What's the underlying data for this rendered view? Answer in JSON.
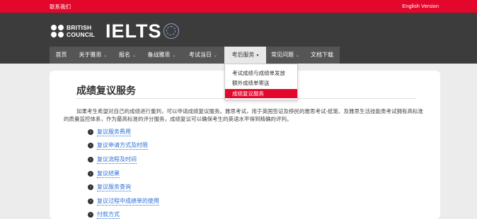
{
  "topbar": {
    "contact_label": "联系我们",
    "english_label": "English Version",
    "accent_color": "#e4072c"
  },
  "header": {
    "bc_logo_line1": "BRITISH",
    "bc_logo_line2": "COUNCIL",
    "ielts_logo": "IELTS"
  },
  "nav": {
    "items": [
      {
        "label": "首页",
        "caret": ""
      },
      {
        "label": "关于雅思",
        "caret": "⌄"
      },
      {
        "label": "报名",
        "caret": "⌄"
      },
      {
        "label": "备战雅思",
        "caret": "⌄"
      },
      {
        "label": "考试当日",
        "caret": "⌄"
      },
      {
        "label": "考后服务",
        "caret": "▾"
      },
      {
        "label": "常见问题",
        "caret": "⌄"
      },
      {
        "label": "文档下载",
        "caret": ""
      }
    ]
  },
  "dropdown": {
    "items": [
      {
        "label": "考试成绩与成绩单发放"
      },
      {
        "label": "额外成绩单寄送"
      },
      {
        "label": "成绩复议服务"
      }
    ]
  },
  "main": {
    "title": "成绩复议服务",
    "intro": "如果考生希望对自己的成绩进行重判，可以申请成绩复议服务。雅思考试，用于英国签证及移民的雅思考试-纸笔、及雅思生活技能类考试拥有高标准的质量监控体系，作为最高标准的评分服务，成绩复议可以确保考生的英语水平得到精确的评判。",
    "links": [
      {
        "label": "复议服务费用"
      },
      {
        "label": "复议申请方式及时限"
      },
      {
        "label": "复议流程及时间"
      },
      {
        "label": "复议结果"
      },
      {
        "label": "复议服务查询"
      },
      {
        "label": "复议过程中成绩单的使用"
      },
      {
        "label": "付款方式"
      }
    ]
  }
}
